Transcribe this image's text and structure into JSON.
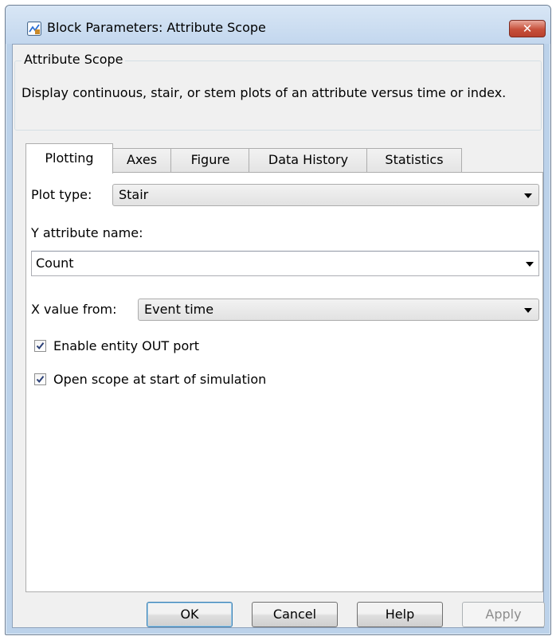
{
  "window": {
    "title": "Block Parameters: Attribute Scope",
    "close_label": "✕"
  },
  "description": {
    "legend": "Attribute Scope",
    "text": "Display continuous, stair, or stem plots of an attribute versus time or index."
  },
  "tabs": [
    {
      "label": "Plotting",
      "active": true
    },
    {
      "label": "Axes"
    },
    {
      "label": "Figure"
    },
    {
      "label": "Data History"
    },
    {
      "label": "Statistics"
    }
  ],
  "plotting": {
    "plot_type_label": "Plot type:",
    "plot_type_value": "Stair",
    "y_attr_label": "Y attribute name:",
    "y_attr_value": "Count",
    "x_value_label": "X value from:",
    "x_value_value": "Event time",
    "enable_out_label": "Enable entity OUT port",
    "enable_out_checked": true,
    "open_scope_label": "Open scope at start of simulation",
    "open_scope_checked": true
  },
  "buttons": {
    "ok": "OK",
    "cancel": "Cancel",
    "help": "Help",
    "apply": "Apply"
  }
}
